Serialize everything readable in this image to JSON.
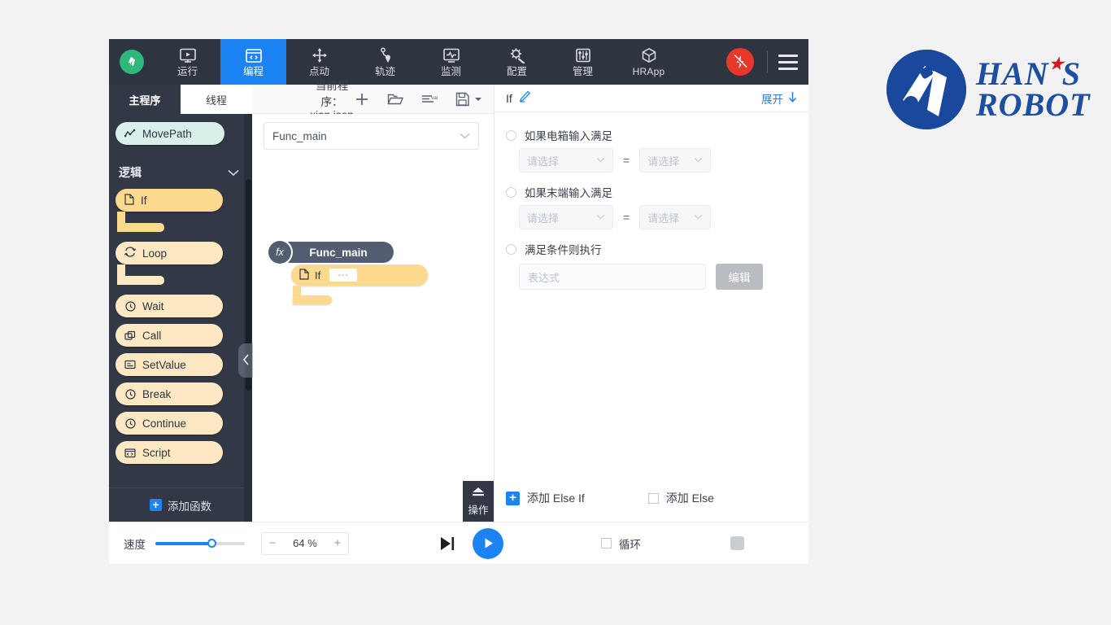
{
  "topnav": {
    "brand_icon": "hans-robot-mark-icon",
    "items": [
      {
        "label": "运行",
        "icon": "run-monitor-icon",
        "active": false
      },
      {
        "label": "编程",
        "icon": "code-window-icon",
        "active": true
      },
      {
        "label": "点动",
        "icon": "jog-arrows-icon",
        "active": false
      },
      {
        "label": "轨迹",
        "icon": "trajectory-pin-icon",
        "active": false
      },
      {
        "label": "监测",
        "icon": "monitor-wave-icon",
        "active": false
      },
      {
        "label": "配置",
        "icon": "gear-wrench-icon",
        "active": false
      },
      {
        "label": "管理",
        "icon": "sliders-panel-icon",
        "active": false
      },
      {
        "label": "HRApp",
        "icon": "cube-icon",
        "active": false
      }
    ],
    "estop_label": "emergency-stop",
    "menu_label": "menu"
  },
  "sidebar": {
    "tabs": [
      {
        "label": "主程序",
        "active": true
      },
      {
        "label": "线程",
        "active": false
      }
    ],
    "top_blocks": [
      {
        "label": "MovePath",
        "icon": "path-wave-icon",
        "style": "mint"
      }
    ],
    "section": {
      "label": "逻辑",
      "chevron": "chevron-down-icon"
    },
    "blocks": [
      {
        "label": "If",
        "icon": "file-icon",
        "shape": "c"
      },
      {
        "label": "Loop",
        "icon": "loop-arrows-icon",
        "shape": "c"
      },
      {
        "label": "Wait",
        "icon": "clock-icon",
        "shape": "plain"
      },
      {
        "label": "Call",
        "icon": "call-stack-icon",
        "shape": "plain"
      },
      {
        "label": "SetValue",
        "icon": "value-box-icon",
        "shape": "plain"
      },
      {
        "label": "Break",
        "icon": "clock-icon",
        "shape": "plain"
      },
      {
        "label": "Continue",
        "icon": "clock-icon",
        "shape": "plain"
      },
      {
        "label": "Script",
        "icon": "script-icon",
        "shape": "plain"
      }
    ],
    "add_function": "添加函数",
    "collapse": "‹"
  },
  "program": {
    "title": "当前程序：xian.json",
    "icons": [
      {
        "name": "new-program-icon",
        "glyph": "+"
      },
      {
        "name": "open-folder-icon",
        "glyph": "folder"
      },
      {
        "name": "variables-icon",
        "glyph": "var"
      },
      {
        "name": "save-icon",
        "glyph": "save"
      }
    ],
    "function_select": {
      "value": "Func_main",
      "chevron": "chevron-down-icon"
    },
    "tree": {
      "root": {
        "label": "Func_main",
        "badge": "fx"
      },
      "child": {
        "label": "If",
        "slot": "---",
        "icon": "file-icon"
      }
    },
    "op_tab": {
      "label": "操作",
      "icon": "eject-up-icon"
    }
  },
  "right_panel": {
    "title": "If",
    "edit_icon": "pencil-icon",
    "expand_label": "展开",
    "expand_icon": "arrow-down-icon",
    "conditions": [
      {
        "label": "如果电箱输入满足",
        "selected": false,
        "left": {
          "placeholder": "请选择"
        },
        "operator": "=",
        "right": {
          "placeholder": "请选择"
        }
      },
      {
        "label": "如果末端输入满足",
        "selected": false,
        "left": {
          "placeholder": "请选择"
        },
        "operator": "=",
        "right": {
          "placeholder": "请选择"
        }
      }
    ],
    "expression_row": {
      "label": "满足条件则执行",
      "selected": false,
      "placeholder": "表达式",
      "value": "",
      "edit_button": "编辑"
    },
    "add_else_if": "添加 Else If",
    "add_else": "添加 Else"
  },
  "bottom": {
    "speed_label": "速度",
    "speed_percent": 64,
    "stepper": {
      "minus": "−",
      "value": "64 %",
      "plus": "+"
    },
    "step_button": "step-forward-icon",
    "play_button": "play-icon",
    "loop_label": "循环",
    "loop_checked": false,
    "stop_button": "stop-icon"
  },
  "logo": {
    "line1": "HAN",
    "line1b": "S",
    "line2": "ROBOT",
    "star": "★"
  },
  "colors": {
    "accent": "#1b84f2",
    "nav_bg": "#2f3540",
    "sidebar_bg": "#323845",
    "block_amber": "#fbd98e",
    "block_amber_light": "#fce9c3",
    "block_mint": "#d9f0ea",
    "estop_red": "#e8372b",
    "brand_blue": "#1a489c"
  }
}
